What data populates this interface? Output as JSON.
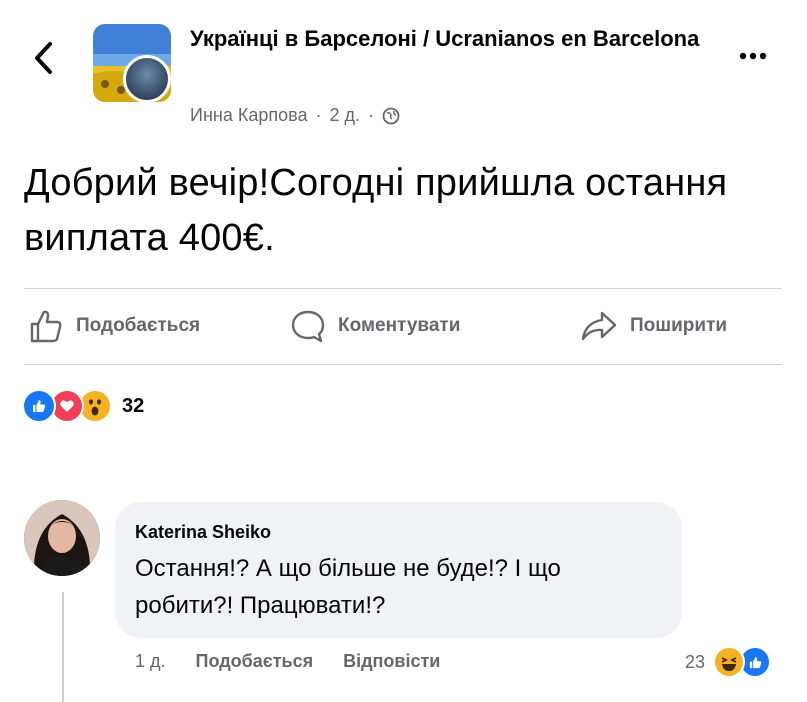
{
  "header": {
    "group_name": "Українці в Барселоні / Ucranianos en Barcelona",
    "author": "Инна Карпова",
    "sep1": "·",
    "time": "2 д.",
    "sep2": "·",
    "audience_icon": "globe-icon",
    "more_icon": "more-icon",
    "back_icon": "chevron-left-icon"
  },
  "post": {
    "text": "Добрий вечір!Cогодні прийшла остання виплата 400€."
  },
  "actions": {
    "like": "Подобається",
    "comment": "Коментувати",
    "share": "Поширити"
  },
  "reactions": {
    "types": [
      "like",
      "love",
      "wow"
    ],
    "count": "32"
  },
  "comment": {
    "author": "Katerina Sheiko",
    "text": "Остання!? А що більше не буде!? І що робити?! Працювати!?",
    "time": "1 д.",
    "like": "Подобається",
    "reply": "Відповісти",
    "reaction_count": "23",
    "reaction_types": [
      "haha",
      "like"
    ]
  },
  "colors": {
    "like_blue": "#1877f2",
    "love_red": "#f33e58",
    "wow_yellow": "#f7b125",
    "secondary_text": "#65676b",
    "bubble_bg": "#f0f2f5"
  }
}
